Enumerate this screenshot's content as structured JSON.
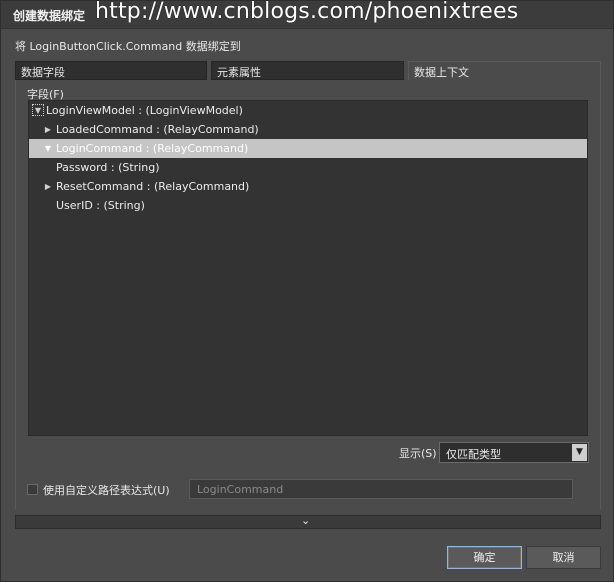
{
  "window": {
    "title": "创建数据绑定",
    "watermark": "http://www.cnblogs.com/phoenixtrees"
  },
  "subtitle": "将 LoginButtonClick.Command 数据绑定到",
  "tabs": [
    {
      "label": "数据字段",
      "active": false
    },
    {
      "label": "元素属性",
      "active": false
    },
    {
      "label": "数据上下文",
      "active": true
    }
  ],
  "fields": {
    "label": "字段(F)",
    "items": [
      {
        "label": "LoginViewModel : (LoginViewModel)",
        "expander": "▼",
        "level": 0,
        "selected": false
      },
      {
        "label": "LoadedCommand : (RelayCommand)",
        "expander": "▶",
        "level": 1,
        "selected": false
      },
      {
        "label": "LoginCommand : (RelayCommand)",
        "expander": "▼",
        "level": 1,
        "selected": true
      },
      {
        "label": "Password : (String)",
        "expander": "",
        "level": 1,
        "selected": false
      },
      {
        "label": "ResetCommand : (RelayCommand)",
        "expander": "▶",
        "level": 1,
        "selected": false
      },
      {
        "label": "UserID : (String)",
        "expander": "",
        "level": 1,
        "selected": false
      }
    ]
  },
  "show": {
    "label": "显示(S)",
    "selected": "仅匹配类型"
  },
  "custom_path": {
    "label": "使用自定义路径表达式(U)",
    "checked": false,
    "value": "LoginCommand"
  },
  "buttons": {
    "ok": "确定",
    "cancel": "取消"
  },
  "colors": {
    "background": "#4b4b4b",
    "tree_background": "#333333",
    "selection": "#c5c5c5",
    "ok_border": "#9ab6d6"
  }
}
